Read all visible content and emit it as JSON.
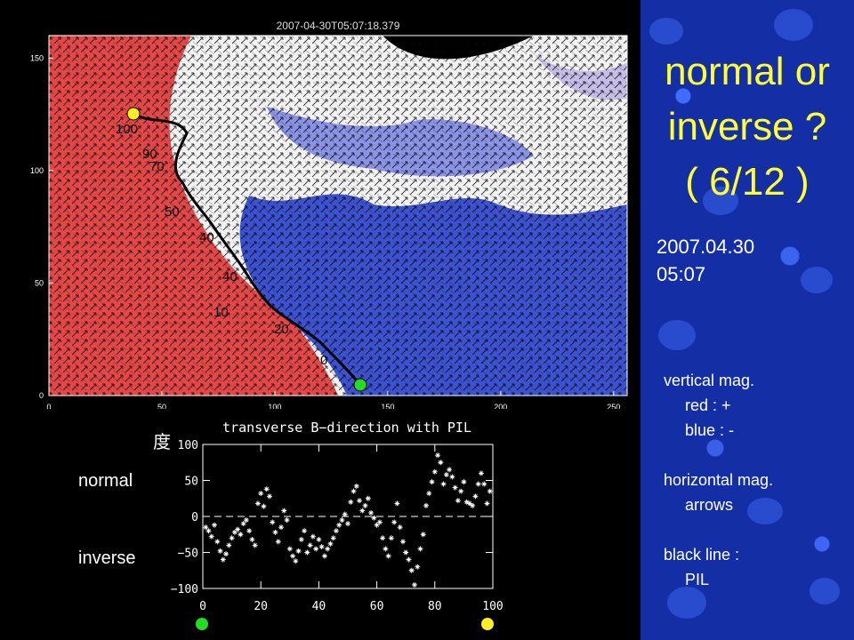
{
  "map": {
    "timestamp": "2007-04-30T05:07:18.379",
    "x_ticks": [
      "0",
      "50",
      "100",
      "150",
      "200",
      "250"
    ],
    "y_ticks": [
      "0",
      "50",
      "100",
      "150"
    ],
    "contour_labels": [
      "100",
      "90",
      "70",
      "50",
      "40",
      "40",
      "10",
      "20",
      "0"
    ],
    "colors": {
      "positive": "#e24848",
      "negative": "#3d52cf"
    }
  },
  "sidebar": {
    "title_lines": [
      "normal or",
      "inverse ?",
      "( 6/12 )"
    ],
    "date": "2007.04.30",
    "time": "05:07",
    "legend": [
      "vertical mag.",
      "red : +",
      "blue : -",
      "",
      "horizontal mag.",
      "arrows",
      "",
      "black line :",
      "PIL"
    ]
  },
  "labels": {
    "unit": "度",
    "normal": "normal",
    "inverse": "inverse"
  },
  "markers": {
    "start_color": "#22dd22",
    "end_color": "#ffee22"
  },
  "chart_data": {
    "type": "scatter",
    "title": "transverse B−direction with PIL",
    "xlabel": "",
    "ylabel": "",
    "xlim": [
      0,
      100
    ],
    "ylim": [
      -100,
      100
    ],
    "x_ticks": [
      "0",
      "20",
      "40",
      "60",
      "80",
      "100"
    ],
    "y_ticks": [
      "100",
      "50",
      "0",
      "−50",
      "−100"
    ],
    "reference_line_y": 0,
    "grid": false,
    "series": [
      {
        "x": [
          1,
          2,
          3,
          4,
          5,
          6,
          7,
          8,
          9,
          10,
          11,
          12,
          13,
          14,
          15,
          16,
          17,
          18,
          19,
          20,
          21,
          22,
          23,
          24,
          25,
          26,
          27,
          28,
          29,
          30,
          31,
          32,
          33,
          34,
          35,
          36,
          37,
          38,
          39,
          40,
          41,
          42,
          43,
          44,
          45,
          46,
          47,
          48,
          49,
          50,
          51,
          52,
          53,
          54,
          55,
          56,
          57,
          58,
          59,
          60,
          61,
          62,
          63,
          64,
          65,
          66,
          67,
          68,
          69,
          70,
          71,
          72,
          73,
          74,
          75,
          76,
          77,
          78,
          79,
          80,
          81,
          82,
          83,
          84,
          85,
          86,
          87,
          88,
          89,
          90,
          91,
          92,
          93,
          94,
          95,
          96,
          97,
          98,
          99
        ],
        "y": [
          -15,
          -20,
          -28,
          -12,
          -35,
          -48,
          -60,
          -52,
          -40,
          -30,
          -22,
          -18,
          -25,
          -10,
          -5,
          -20,
          -32,
          -40,
          18,
          32,
          14,
          38,
          28,
          -8,
          -22,
          -35,
          -15,
          8,
          -5,
          -45,
          -55,
          -62,
          -48,
          -32,
          -20,
          -50,
          -40,
          -28,
          -45,
          -32,
          -42,
          -55,
          -45,
          -38,
          -30,
          -20,
          -12,
          -5,
          3,
          -10,
          20,
          35,
          42,
          22,
          8,
          15,
          25,
          5,
          -2,
          -12,
          -8,
          -30,
          -45,
          -55,
          -30,
          -8,
          18,
          -15,
          -35,
          -50,
          -60,
          -75,
          -95,
          -70,
          -45,
          -25,
          15,
          32,
          48,
          62,
          85,
          75,
          45,
          58,
          65,
          55,
          40,
          22,
          35,
          48,
          20,
          18,
          15,
          28,
          45,
          60,
          45,
          18,
          35
        ]
      }
    ]
  }
}
